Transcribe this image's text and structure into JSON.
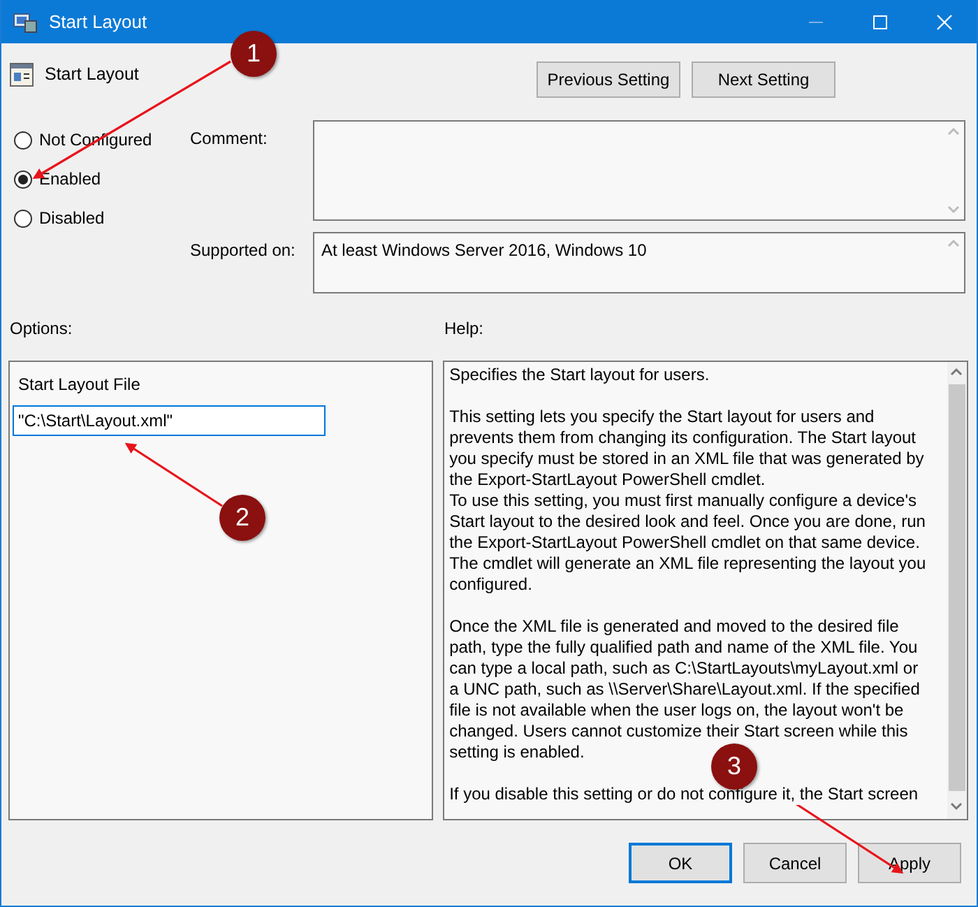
{
  "window": {
    "title": "Start Layout"
  },
  "policy": {
    "name": "Start Layout"
  },
  "nav_buttons": [
    "Previous Setting",
    "Next Setting"
  ],
  "states": [
    {
      "label": "Not Configured",
      "selected": false
    },
    {
      "label": "Enabled",
      "selected": true
    },
    {
      "label": "Disabled",
      "selected": false
    }
  ],
  "comment": {
    "label": "Comment:"
  },
  "supported_on": {
    "label": "Supported on:",
    "value": "At least Windows Server 2016, Windows 10"
  },
  "options": {
    "label": "Options:",
    "field_label": "Start Layout File",
    "value": "\"C:\\Start\\Layout.xml\""
  },
  "help": {
    "label": "Help:",
    "text": "Specifies the Start layout for users.\n\nThis setting lets you specify the Start layout for users and prevents them from changing its configuration. The Start layout you specify must be stored in an XML file that was generated by the Export-StartLayout PowerShell cmdlet.\nTo use this setting, you must first manually configure a device's Start layout to the desired look and feel. Once you are done, run the Export-StartLayout PowerShell cmdlet on that same device. The cmdlet will generate an XML file representing the layout you configured.\n\nOnce the XML file is generated and moved to the desired file path, type the fully qualified path and name of the XML file. You can type a local path, such as C:\\StartLayouts\\myLayout.xml or a UNC path, such as \\\\Server\\Share\\Layout.xml. If the specified file is not available when the user logs on, the layout won't be changed. Users cannot customize their Start screen while this setting is enabled.\n\nIf you disable this setting or do not configure it, the Start screen"
  },
  "buttons": [
    {
      "label": "OK",
      "default": true
    },
    {
      "label": "Cancel",
      "default": false
    },
    {
      "label": "Apply",
      "default": false
    }
  ],
  "annotations": [
    {
      "label": "1"
    },
    {
      "label": "2"
    },
    {
      "label": "3"
    }
  ]
}
